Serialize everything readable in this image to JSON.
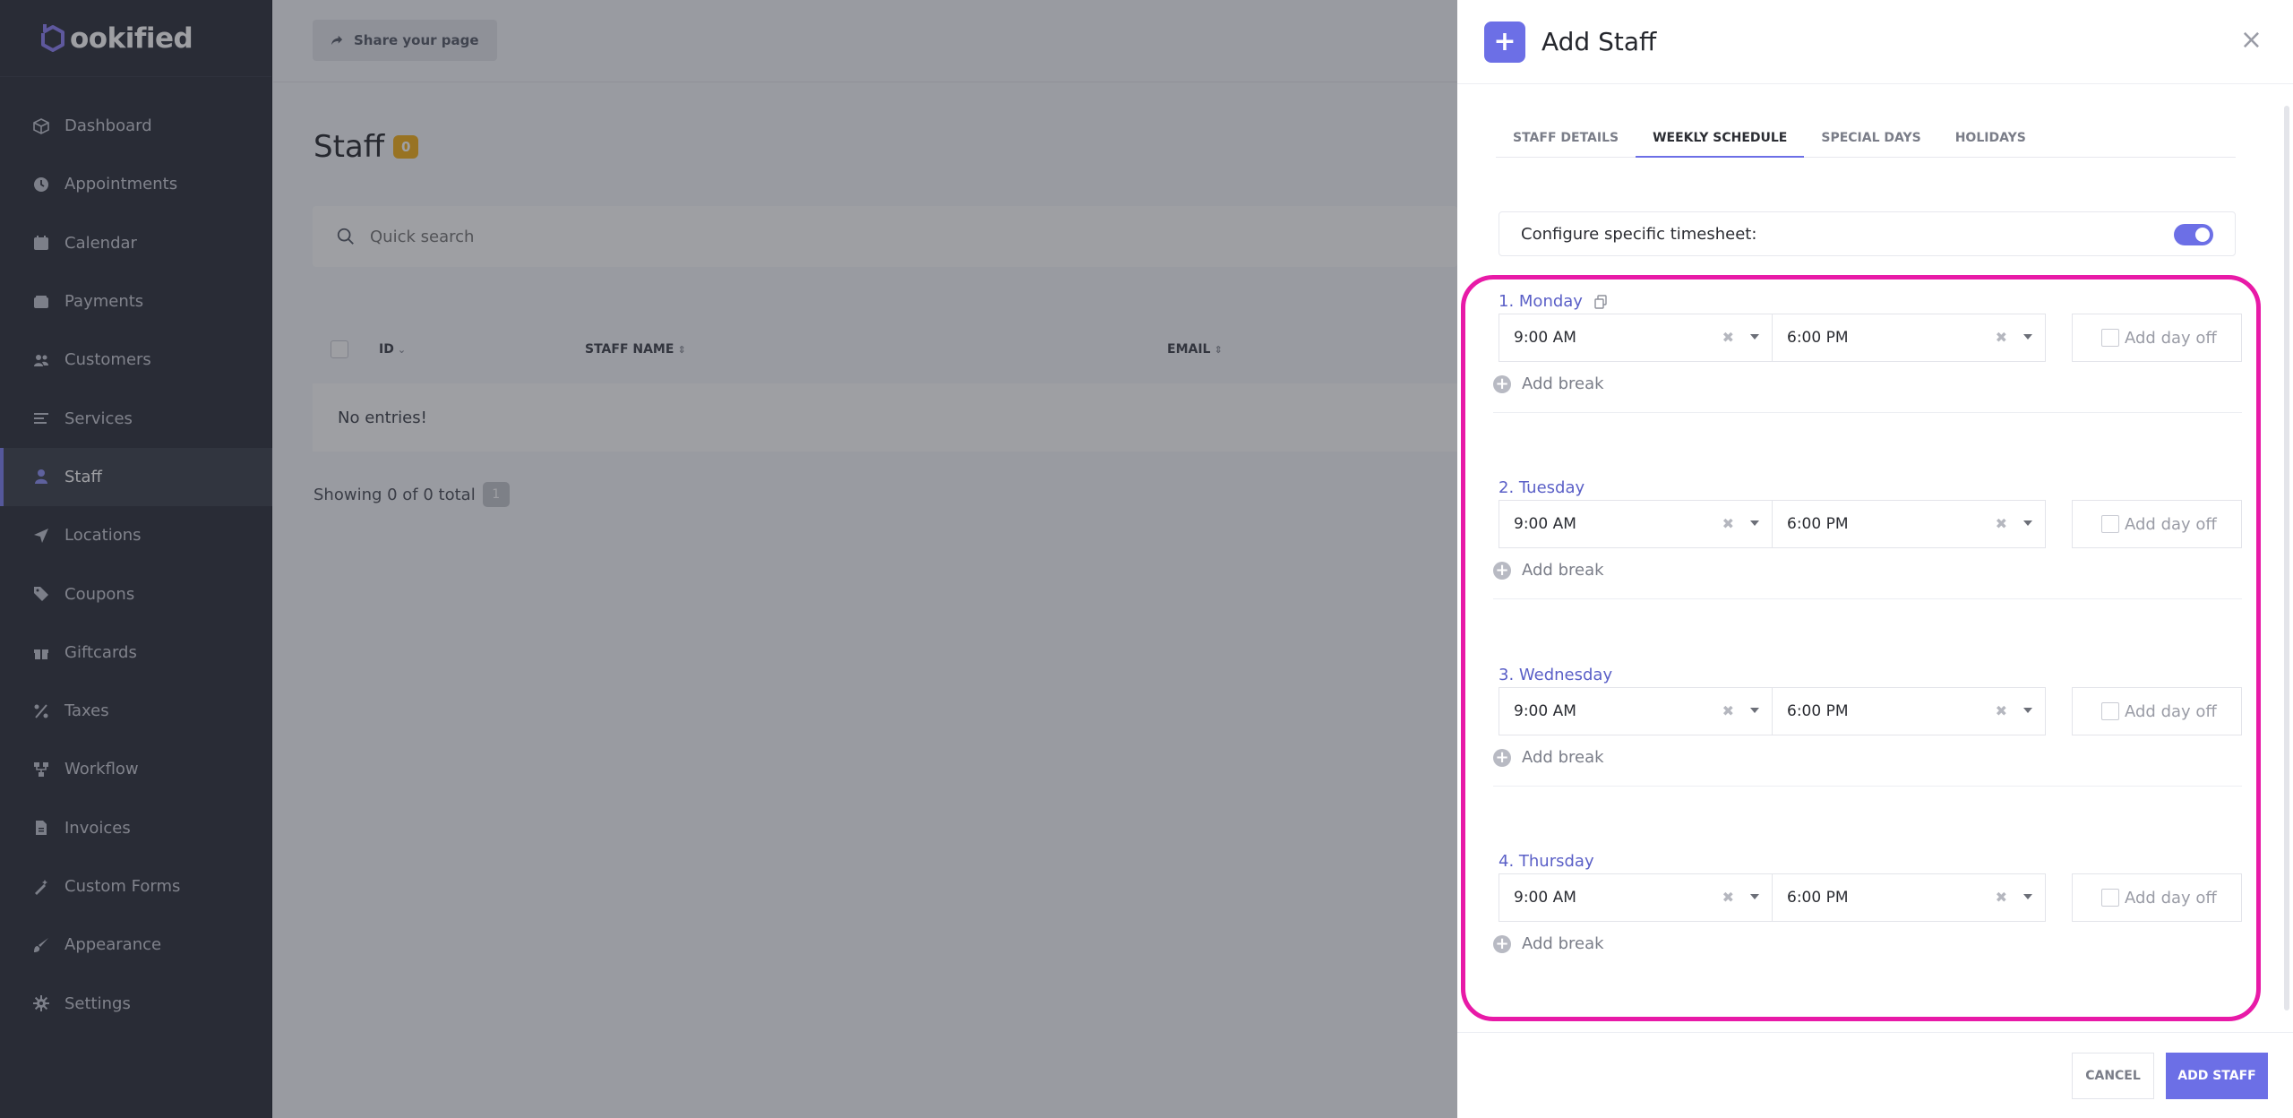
{
  "brand": {
    "logo_text": "ookified"
  },
  "sidebar": {
    "items": [
      {
        "label": "Dashboard",
        "icon": "box-icon"
      },
      {
        "label": "Appointments",
        "icon": "clock-icon"
      },
      {
        "label": "Calendar",
        "icon": "calendar-icon"
      },
      {
        "label": "Payments",
        "icon": "wallet-icon"
      },
      {
        "label": "Customers",
        "icon": "users-icon"
      },
      {
        "label": "Services",
        "icon": "list-icon"
      },
      {
        "label": "Staff",
        "icon": "user-icon",
        "active": true
      },
      {
        "label": "Locations",
        "icon": "location-arrow-icon"
      },
      {
        "label": "Coupons",
        "icon": "tag-icon"
      },
      {
        "label": "Giftcards",
        "icon": "gift-icon"
      },
      {
        "label": "Taxes",
        "icon": "percent-icon"
      },
      {
        "label": "Workflow",
        "icon": "workflow-icon"
      },
      {
        "label": "Invoices",
        "icon": "file-icon"
      },
      {
        "label": "Custom Forms",
        "icon": "magic-icon"
      },
      {
        "label": "Appearance",
        "icon": "brush-icon"
      },
      {
        "label": "Settings",
        "icon": "gear-icon"
      }
    ]
  },
  "main": {
    "share_label": "Share your page",
    "title": "Staff",
    "count": "0",
    "search_placeholder": "Quick search",
    "columns": {
      "id": "ID",
      "name": "STAFF NAME",
      "email": "EMAIL"
    },
    "empty_text": "No entries!",
    "showing_text": "Showing 0 of 0 total",
    "page": "1"
  },
  "panel": {
    "title": "Add Staff",
    "close": "×",
    "tabs": [
      "STAFF DETAILS",
      "WEEKLY SCHEDULE",
      "SPECIAL DAYS",
      "HOLIDAYS"
    ],
    "active_tab": "WEEKLY SCHEDULE",
    "configure_label": "Configure specific timesheet:",
    "configure_on": true,
    "add_break_label": "Add break",
    "day_off_label": "Add day off",
    "days": [
      {
        "name": "1. Monday",
        "start": "9:00 AM",
        "end": "6:00 PM"
      },
      {
        "name": "2. Tuesday",
        "start": "9:00 AM",
        "end": "6:00 PM"
      },
      {
        "name": "3. Wednesday",
        "start": "9:00 AM",
        "end": "6:00 PM"
      },
      {
        "name": "4. Thursday",
        "start": "9:00 AM",
        "end": "6:00 PM"
      }
    ],
    "cancel_label": "CANCEL",
    "submit_label": "ADD STAFF"
  },
  "colors": {
    "accent": "#6c6fe6",
    "highlight": "#e81aa7",
    "badge": "#f5b016",
    "sidebar_bg": "#2b2f3a"
  }
}
